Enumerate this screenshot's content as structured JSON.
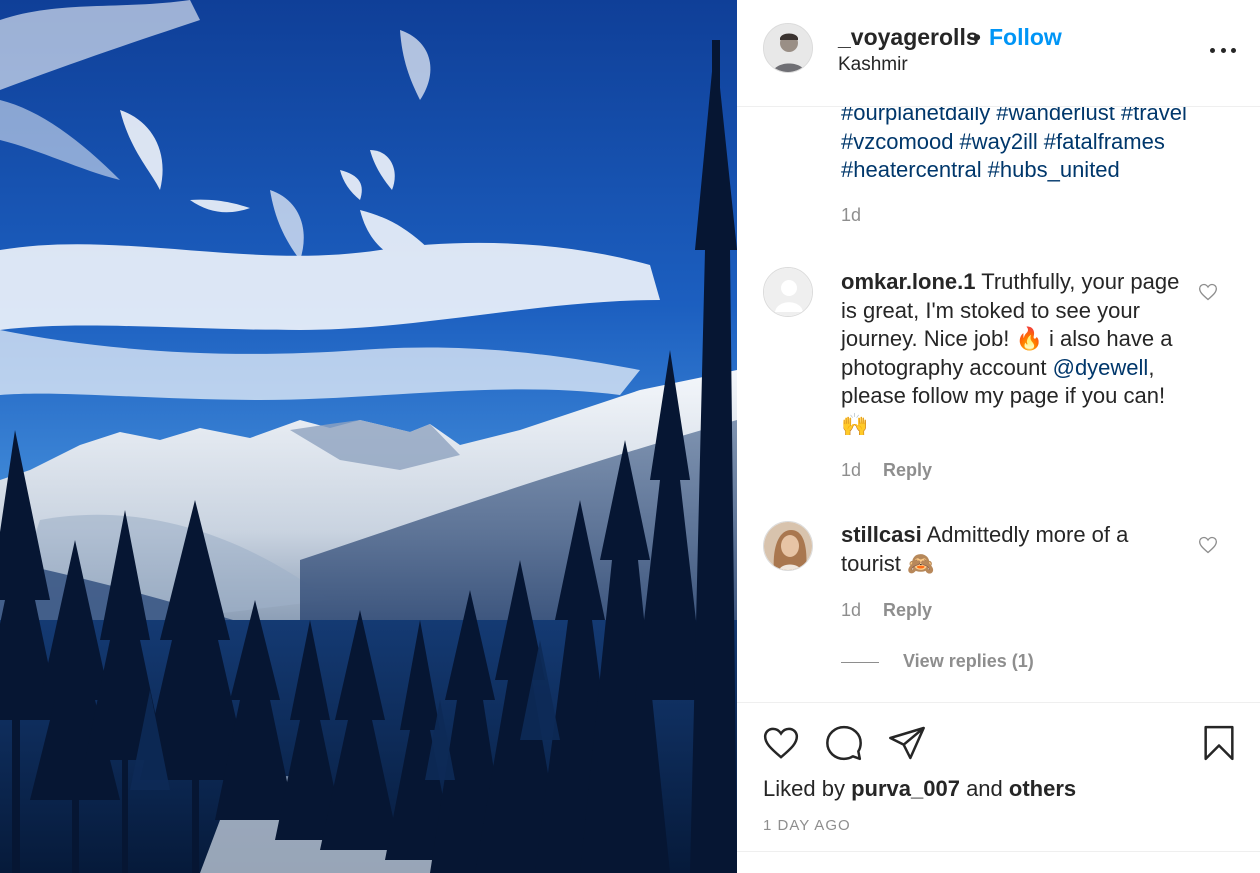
{
  "post": {
    "author": {
      "username": "_voyagerolls",
      "follow_label": "Follow",
      "separator": "•",
      "location": "Kashmir"
    },
    "hashtags": [
      "#ourplanetdaily",
      "#wanderlust",
      "#travel",
      "#vzcomood",
      "#way2ill",
      "#fatalframes",
      "#heatercentral",
      "#hubs_united"
    ],
    "caption_time": "1d",
    "comments": [
      {
        "username": "omkar.lone.1",
        "text_before_mention": "Truthfully, your page is great, I'm stoked to see your journey. Nice job! 🔥  i also have a photography account ",
        "mention": "@dyewell",
        "text_after_mention": ", please follow my page if you can! 🙌",
        "time": "1d",
        "reply_label": "Reply"
      },
      {
        "username": "stillcasi",
        "text": "Admittedly more of a tourist 🙈",
        "time": "1d",
        "reply_label": "Reply",
        "view_replies_label": "View replies (1)"
      }
    ],
    "likes": {
      "prefix": "Liked by",
      "user": "purva_007",
      "joiner": "and",
      "others": "others"
    },
    "posted_ago": "1 DAY AGO"
  },
  "colors": {
    "link": "#0095f6",
    "hashtag": "#00376b",
    "muted": "#8e8e8e",
    "text": "#262626"
  },
  "icons": [
    "more-options-icon",
    "heart-outline-icon",
    "comment-icon",
    "share-icon",
    "bookmark-icon"
  ]
}
